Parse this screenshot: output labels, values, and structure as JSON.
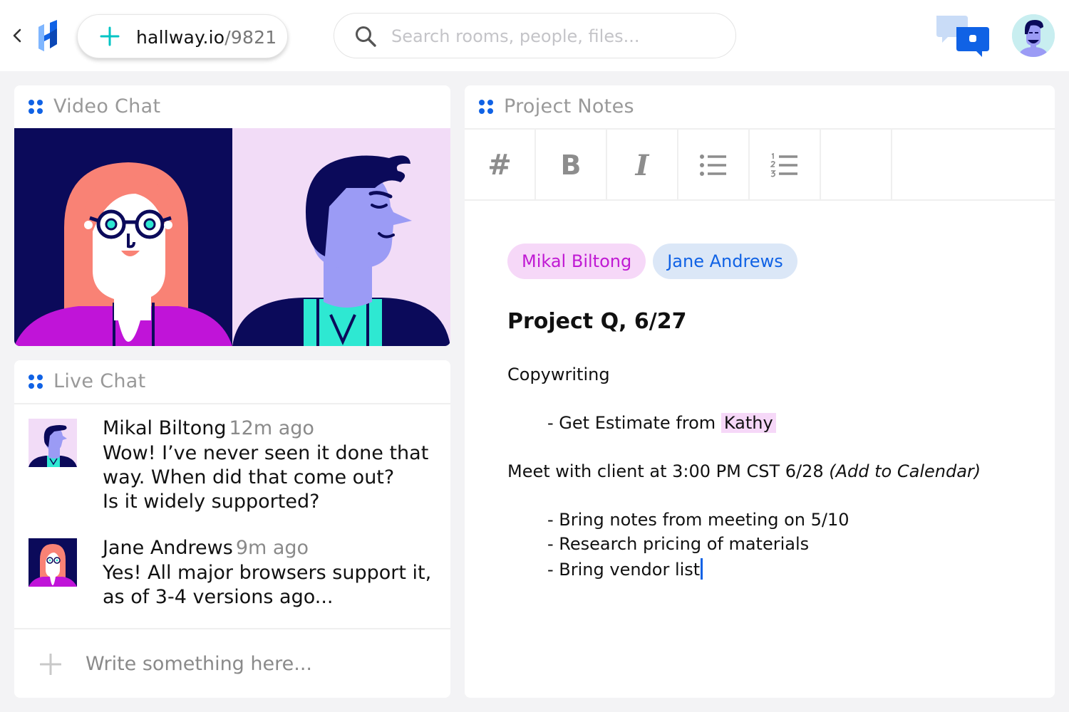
{
  "topbar": {
    "url_host": "hallway.io",
    "url_path": "/9821",
    "search_placeholder": "Search rooms, people, files...",
    "icons": [
      "back-chevron-icon",
      "hallway-logo",
      "plus-icon",
      "search-icon",
      "chat-bubbles-icon",
      "user-avatar"
    ]
  },
  "video_chat": {
    "title": "Video Chat",
    "participants": [
      "participant-woman",
      "participant-man"
    ]
  },
  "live_chat": {
    "title": "Live Chat",
    "messages": [
      {
        "name": "Mikal Biltong",
        "time": "12m ago",
        "text": "Wow! I’ve never seen it done that\nway. When did that come out?\nIs it widely supported?"
      },
      {
        "name": "Jane Andrews",
        "time": "9m ago",
        "text": "Yes! All major browsers support it,\nas of 3-4 versions ago..."
      }
    ],
    "compose_placeholder": "Write something here..."
  },
  "project_notes": {
    "title": "Project Notes",
    "toolbar": {
      "heading": "#",
      "bold": "B",
      "italic": "I"
    },
    "tags": [
      "Mikal Biltong",
      "Jane Andrews"
    ],
    "doc": {
      "title": "Project Q, 6/27",
      "section1": "Copywriting",
      "item1_prefix": "- Get Estimate from ",
      "item1_mention": "Kathy",
      "section2_text": "Meet with client at 3:00 PM CST 6/28 ",
      "section2_italic": "(Add to Calendar)",
      "items2": [
        "- Bring notes from meeting on 5/10",
        "- Research pricing of materials",
        "- Bring vendor list"
      ]
    }
  },
  "colors": {
    "accent_blue": "#1062e5",
    "accent_pink": "#c01ad3",
    "tag_pink_bg": "#f6d8f8",
    "tag_blue_bg": "#dbe7f7",
    "page_bg": "#f3f3f5",
    "navy": "#0b0a5a",
    "teal": "#2ee8d2",
    "lavender": "#9b9bf5"
  }
}
